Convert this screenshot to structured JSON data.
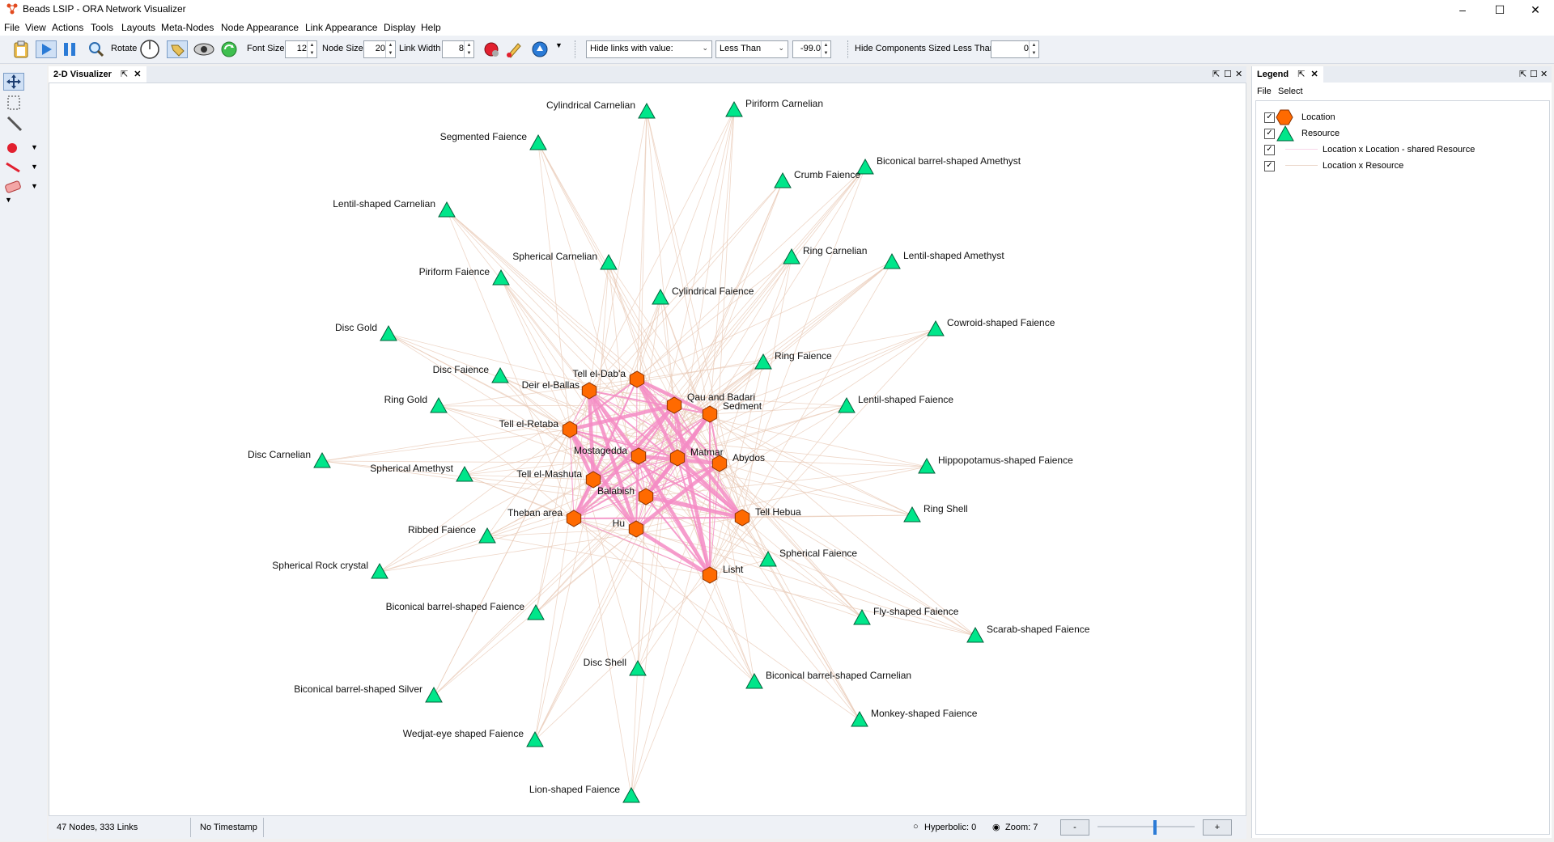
{
  "window": {
    "title": "Beads LSIP - ORA Network Visualizer",
    "min": "–",
    "max": "☐",
    "close": "✕"
  },
  "menu": [
    "File",
    "View",
    "Actions",
    "Tools",
    "Layouts",
    "Meta-Nodes",
    "Node Appearance",
    "Link Appearance",
    "Display",
    "Help"
  ],
  "toolbar": {
    "rotate_label": "Rotate",
    "font_size_label": "Font Size",
    "font_size_value": "12",
    "node_size_label": "Node Size",
    "node_size_value": "20",
    "link_width_label": "Link Width",
    "link_width_value": "8",
    "hide_links_value": "Hide links with value:",
    "comparator_value": "Less Than",
    "threshold_value": "-99.0",
    "hide_components_label": "Hide Components Sized Less Than",
    "hide_components_value": "0"
  },
  "viz_tab": {
    "label": "2-D Visualizer"
  },
  "legend": {
    "tab_label": "Legend",
    "menu": [
      "File",
      "Select"
    ],
    "items": [
      {
        "label": "Location",
        "checked": true,
        "symbol": "hexagon",
        "color": "#ff6a00"
      },
      {
        "label": "Resource",
        "checked": true,
        "symbol": "triangle",
        "color": "#00e68a"
      },
      {
        "label": "Location x Location - shared Resource",
        "checked": true,
        "symbol": "line",
        "color": "#f7b6d9"
      },
      {
        "label": "Location x Resource",
        "checked": true,
        "symbol": "line",
        "color": "#e8c8b4"
      }
    ]
  },
  "status": {
    "counts": "47 Nodes, 333 Links",
    "timestamp": "No Timestamp",
    "hyperbolic": "Hyperbolic: 0",
    "zoom": "Zoom: 7",
    "minus": "-",
    "plus": "+"
  },
  "network": {
    "location_color": "#ff6a00",
    "resource_color": "#00e68a",
    "loc_link_color": "#f58cc4",
    "res_link_color": "#e8c8b4",
    "locations": [
      "Tell el-Dab'a",
      "Deir el-Ballas",
      "Qau and Badari",
      "Sedment",
      "Tell el-Retaba",
      "Mostagedda",
      "Matmar",
      "Abydos",
      "Tell el-Mashuta",
      "Balabish",
      "Theban area",
      "Hu",
      "Tell Hebua",
      "Lisht"
    ],
    "resources": [
      "Cylindrical Carnelian",
      "Piriform Carnelian",
      "Segmented Faience",
      "Biconical barrel-shaped Amethyst",
      "Crumb Faience",
      "Lentil-shaped Carnelian",
      "Spherical Carnelian",
      "Ring Carnelian",
      "Lentil-shaped Amethyst",
      "Piriform Faience",
      "Cylindrical Faience",
      "Cowroid-shaped Faience",
      "Disc Gold",
      "Ring Faience",
      "Disc Faience",
      "Ring Gold",
      "Lentil-shaped Faience",
      "Disc Carnelian",
      "Spherical Amethyst",
      "Hippopotamus-shaped Faience",
      "Ring Shell",
      "Ribbed Faience",
      "Spherical Rock crystal",
      "Spherical Faience",
      "Biconical barrel-shaped Faience",
      "Fly-shaped Faience",
      "Scarab-shaped Faience",
      "Disc Shell",
      "Biconical barrel-shaped Carnelian",
      "Biconical barrel-shaped Silver",
      "Monkey-shaped Faience",
      "Wedjat-eye shaped Faience",
      "Lion-shaped Faience"
    ]
  }
}
